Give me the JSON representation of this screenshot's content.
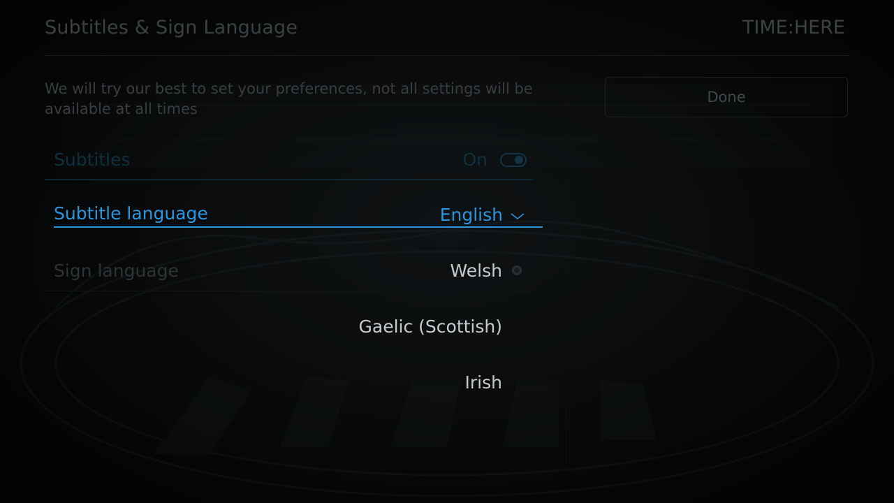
{
  "header": {
    "title": "Subtitles & Sign Language",
    "time": "TIME:HERE"
  },
  "intro_text": "We will try our best to set your preferences, not all settings will be available at all times",
  "done_label": "Done",
  "settings": {
    "subtitles": {
      "label": "Subtitles",
      "value": "On",
      "toggle_on": true
    },
    "subtitle_language": {
      "label": "Subtitle language",
      "value": "English"
    },
    "sign_language": {
      "label": "Sign language"
    }
  },
  "dropdown": {
    "options": [
      "Welsh",
      "Gaelic (Scottish)",
      "Irish"
    ]
  },
  "colors": {
    "accent": "#2d95dd",
    "dim_accent": "#10303f",
    "option_text": "#c8cbcd",
    "muted_text": "#3a3e41"
  },
  "icons": {
    "chevron": "chevron-down-icon",
    "toggle": "toggle-switch-icon",
    "radio": "radio-indicator-icon"
  }
}
